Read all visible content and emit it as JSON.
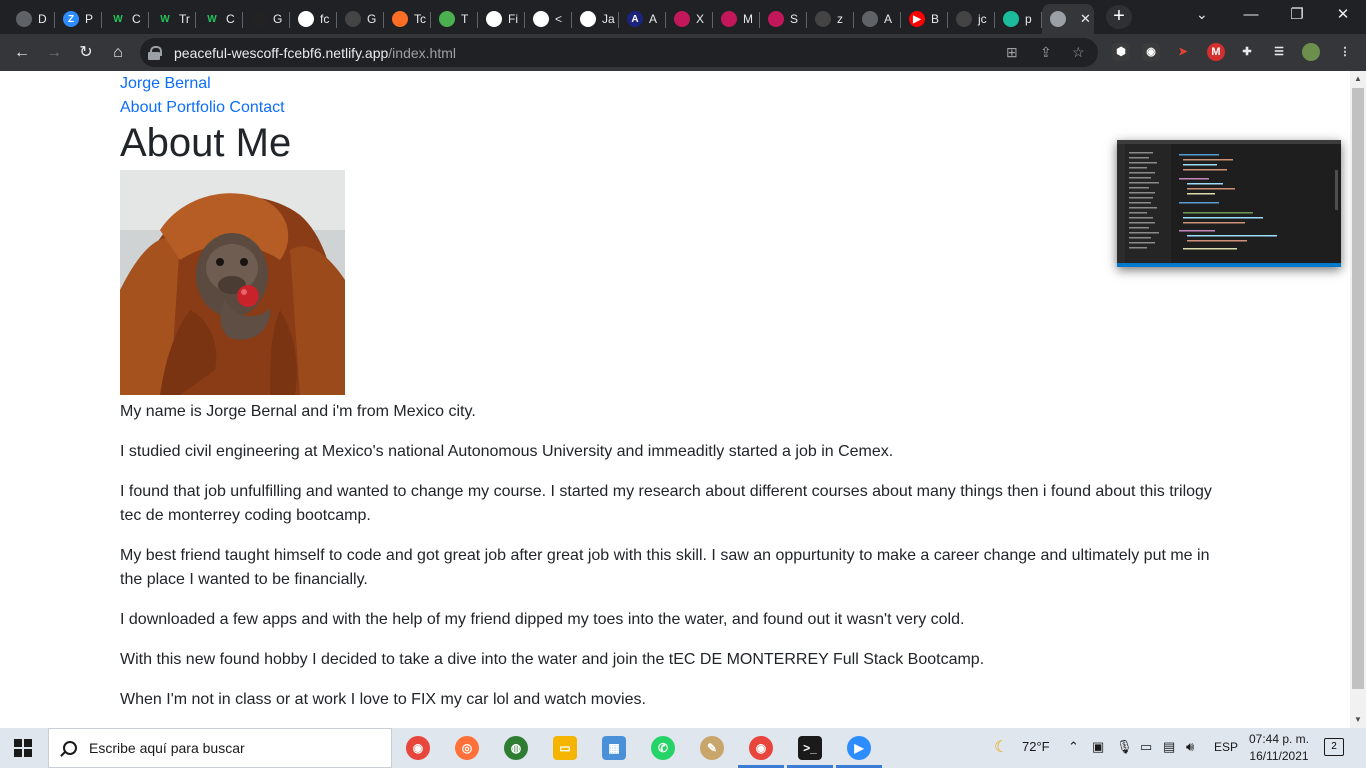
{
  "browser": {
    "tabs": [
      {
        "label": "D",
        "color": "#5f6368",
        "glyph": ""
      },
      {
        "label": "P",
        "color": "#2d8cff",
        "glyph": "Z"
      },
      {
        "label": "C",
        "color": "#0e8a3a",
        "glyph": "W"
      },
      {
        "label": "Tr",
        "color": "#0e8a3a",
        "glyph": "W"
      },
      {
        "label": "C",
        "color": "#0e8a3a",
        "glyph": "W"
      },
      {
        "label": "G",
        "color": "#222222",
        "glyph": ""
      },
      {
        "label": "fc",
        "color": "#ffffff",
        "glyph": ""
      },
      {
        "label": "G",
        "color": "#444444",
        "glyph": ""
      },
      {
        "label": "Tc",
        "color": "#fc6d26",
        "glyph": ""
      },
      {
        "label": "T",
        "color": "#4caf50",
        "glyph": ""
      },
      {
        "label": "Fi",
        "color": "#ffffff",
        "glyph": ""
      },
      {
        "label": "<",
        "color": "#ffffff",
        "glyph": ""
      },
      {
        "label": "Ja",
        "color": "#ffffff",
        "glyph": ""
      },
      {
        "label": "A",
        "color": "#1a237e",
        "glyph": "A"
      },
      {
        "label": "X",
        "color": "#c2185b",
        "glyph": ""
      },
      {
        "label": "M",
        "color": "#c2185b",
        "glyph": ""
      },
      {
        "label": "S",
        "color": "#c2185b",
        "glyph": ""
      },
      {
        "label": "z",
        "color": "#444444",
        "glyph": ""
      },
      {
        "label": "A",
        "color": "#5f6368",
        "glyph": ""
      },
      {
        "label": "B",
        "color": "#ff0000",
        "glyph": "▶"
      },
      {
        "label": "jc",
        "color": "#444444",
        "glyph": ""
      },
      {
        "label": "p",
        "color": "#1abc9c",
        "glyph": ""
      },
      {
        "label": "",
        "color": "#9aa0a6",
        "glyph": ""
      }
    ],
    "new_tab": "+",
    "url_host": "peaceful-wescoff-fcebf6.netlify.app",
    "url_path": "/index.html"
  },
  "page": {
    "site_name": "Jorge Bernal",
    "nav": [
      "About",
      "Portfolio",
      "Contact"
    ],
    "heading": "About Me",
    "paragraphs": [
      "My name is Jorge Bernal and i'm from Mexico city.",
      "I studied civil engineering at Mexico's national Autonomous University and immeaditly started a job in Cemex.",
      "I found that job unfulfilling and wanted to change my course. I started my research about different courses about many things then i found about this trilogy tec de monterrey coding bootcamp.",
      "My best friend taught himself to code and got great job after great job with this skill. I saw an oppurtunity to make a career change and ultimately put me in the place I wanted to be financially.",
      "I downloaded a few apps and with the help of my friend dipped my toes into the water, and found out it wasn't very cold.",
      "With this new found hobby I decided to take a dive into the water and join the tEC DE MONTERREY Full Stack Bootcamp.",
      "When I'm not in class or at work I love to FIX my car lol and watch movies."
    ]
  },
  "taskbar": {
    "search_placeholder": "Escribe aquí para buscar",
    "temperature": "72°F",
    "language": "ESP",
    "time": "07:44 p. m.",
    "date": "16/11/2021",
    "notifications": "2"
  }
}
